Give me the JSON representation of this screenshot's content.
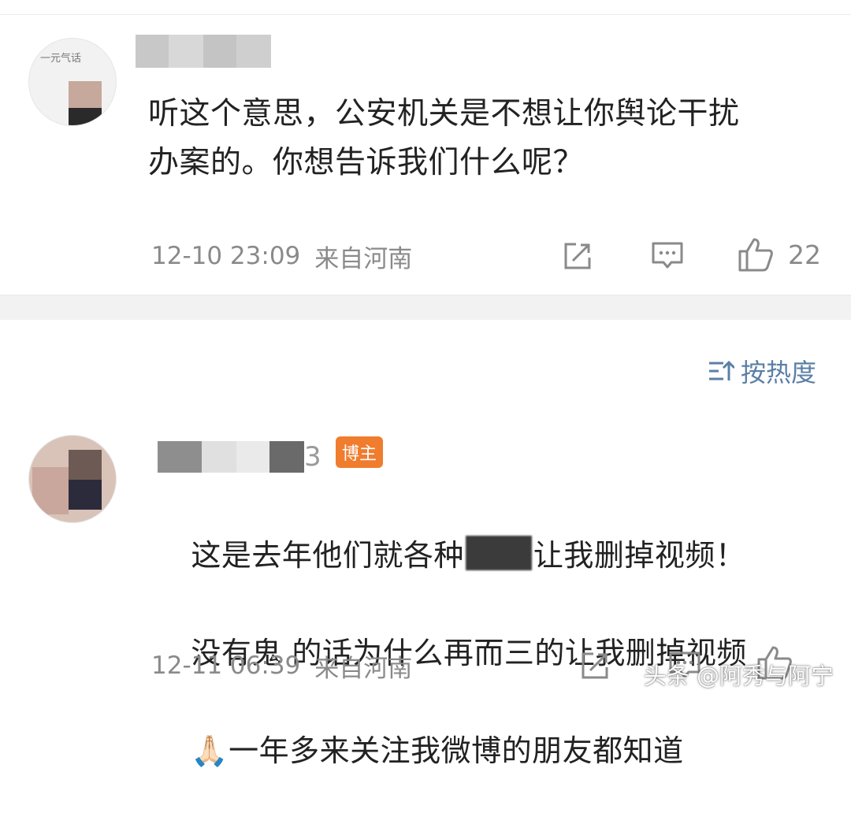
{
  "comments": [
    {
      "avatar_text": "一元气话",
      "text": "听这个意思，公安机关是不想让你舆论干扰\n办案的。你想告诉我们什么呢？",
      "time": "12-10 23:09",
      "location": "来自河南",
      "like_count": "22",
      "icons": [
        "share-icon",
        "comment-icon",
        "like-icon"
      ]
    },
    {
      "badge": "博主",
      "username_visible_char": "3",
      "text_line1_a": "这是去年他们就各种",
      "text_line1_b": "让我删掉视频！",
      "text_line2": "没有鬼 的话为什么再而三的让我删掉视频",
      "text_line3_emoji": "🙏🏻",
      "text_line3": "一年多来关注我微博的朋友都知道",
      "time": "12-11 06:39",
      "location": "来自河南",
      "icons": [
        "share-icon",
        "comment-icon",
        "like-icon"
      ]
    }
  ],
  "sort": {
    "label": "按热度",
    "icon": "sort-icon",
    "color": "#5b7fa6"
  },
  "watermark": "头条 @阿秀与阿宁",
  "colors": {
    "text": "#222222",
    "meta": "#8a8a8a",
    "badge": "#f07c2e",
    "band": "#f2f2f2"
  }
}
